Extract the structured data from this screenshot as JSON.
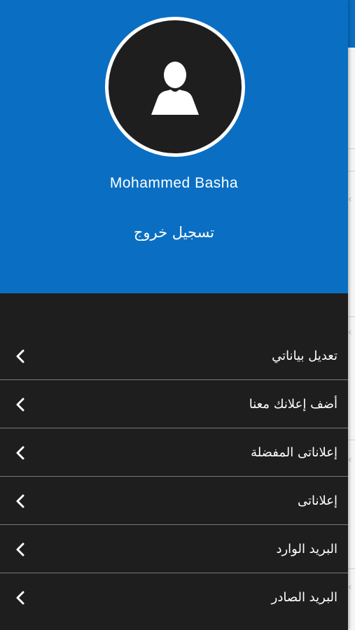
{
  "profile": {
    "name": "Mohammed Basha",
    "avatar_icon": "user-silhouette-icon",
    "logout_label": "تسجيل خروج"
  },
  "menu": {
    "items": [
      {
        "label": "تعديل بياناتي",
        "icon": "chevron-left-icon"
      },
      {
        "label": "أضف إعلانك معنا",
        "icon": "chevron-left-icon"
      },
      {
        "label": "إعلاناتى المفضلة",
        "icon": "chevron-left-icon"
      },
      {
        "label": "إعلاناتى",
        "icon": "chevron-left-icon"
      },
      {
        "label": "البريد الوارد",
        "icon": "chevron-left-icon"
      },
      {
        "label": "البريد الصادر",
        "icon": "chevron-left-icon"
      }
    ]
  },
  "colors": {
    "header_blue": "#0a6fc2",
    "drawer_dark": "#1f1e1f",
    "divider": "#7a7a7a",
    "text": "#ffffff"
  }
}
